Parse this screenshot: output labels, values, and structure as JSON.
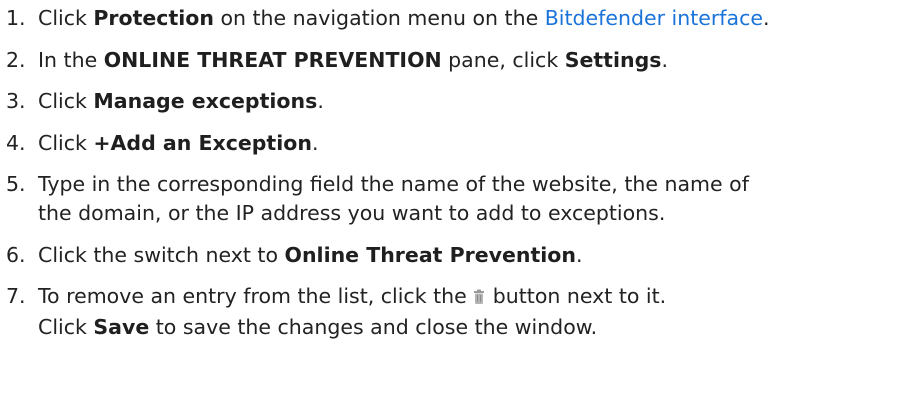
{
  "steps": [
    {
      "num": "1.",
      "t1": "Click ",
      "b1": "Protection",
      "t2": " on the navigation menu on the ",
      "link": "Bitdefender interface",
      "t3": "."
    },
    {
      "num": "2.",
      "t1": "In the ",
      "b1": "ONLINE THREAT PREVENTION",
      "t2": " pane, click ",
      "b2": "Settings",
      "t3": "."
    },
    {
      "num": "3.",
      "t1": "Click ",
      "b1": "Manage exceptions",
      "t2": "."
    },
    {
      "num": "4.",
      "t1": "Click ",
      "b1": "+Add an Exception",
      "t2": "."
    },
    {
      "num": "5.",
      "line1": "Type in the corresponding field the name of the website, the name of",
      "line2": "the domain, or the IP address you want to add to exceptions."
    },
    {
      "num": "6.",
      "t1": "Click the switch next to ",
      "b1": "Online Threat Prevention",
      "t2": "."
    },
    {
      "num": "7.",
      "t1": "To remove an entry from the list, click the",
      "t2": "button next to it.",
      "l2a": "Click ",
      "l2b": "Save",
      "l2c": " to save the changes and close the window."
    }
  ],
  "icons": {
    "remove": "trash-icon"
  },
  "colors": {
    "link": "#1a73d9",
    "text": "#222222"
  }
}
